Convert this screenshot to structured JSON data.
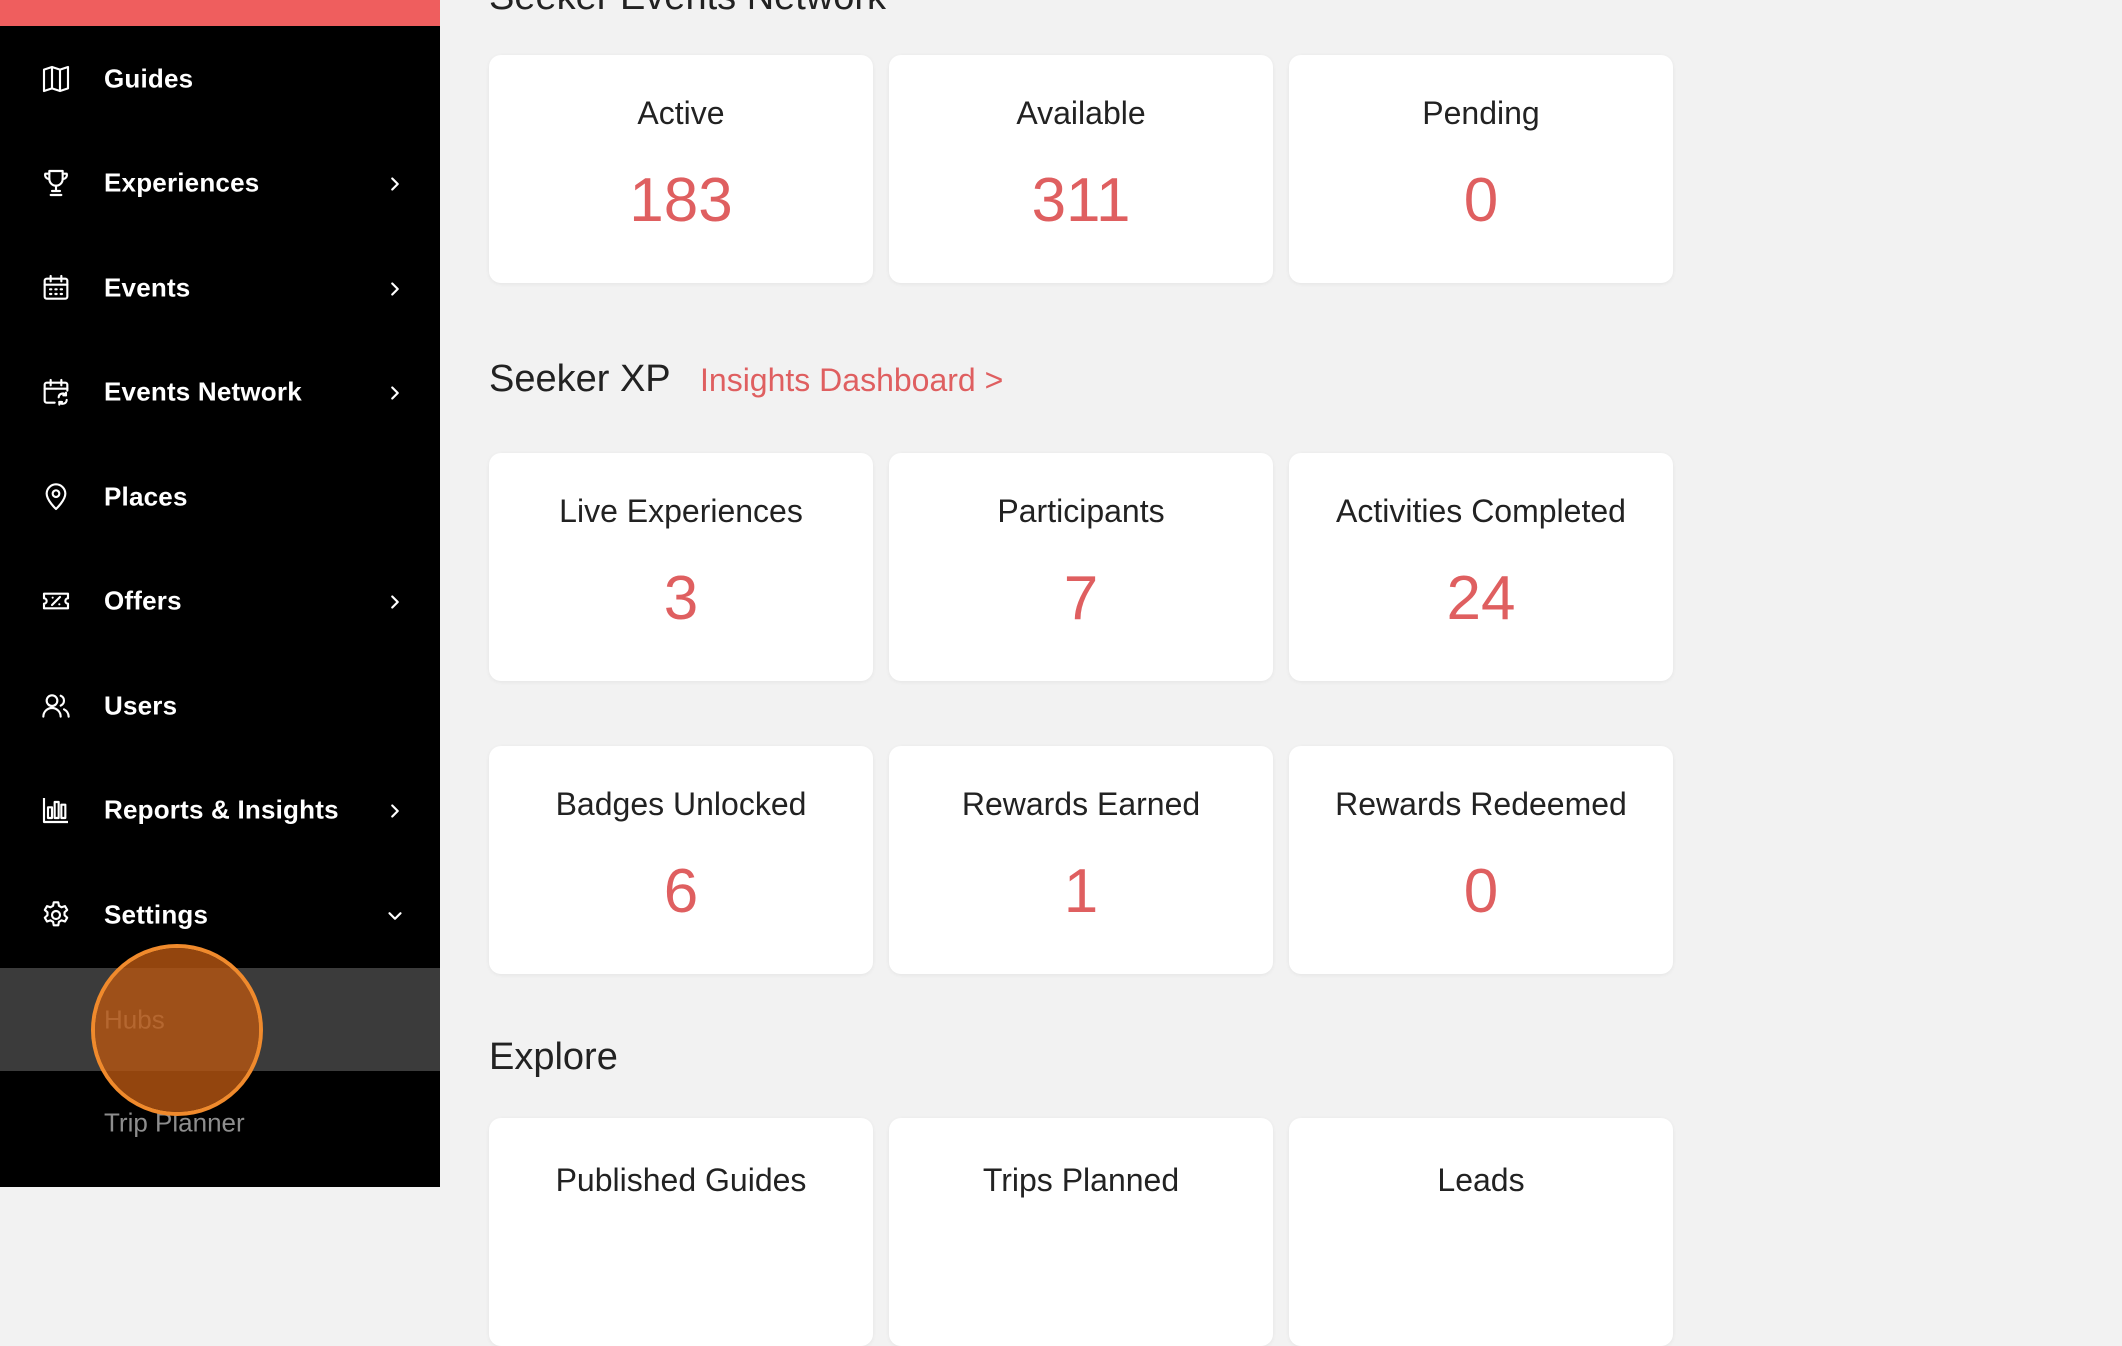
{
  "sidebar": {
    "accent_color": "#ef5e5e",
    "items": [
      {
        "label": "Guides",
        "icon": "map-icon",
        "has_children": false
      },
      {
        "label": "Experiences",
        "icon": "trophy-icon",
        "has_children": true
      },
      {
        "label": "Events",
        "icon": "calendar-icon",
        "has_children": true
      },
      {
        "label": "Events Network",
        "icon": "calendar-sync-icon",
        "has_children": true
      },
      {
        "label": "Places",
        "icon": "map-pin-icon",
        "has_children": false
      },
      {
        "label": "Offers",
        "icon": "ticket-icon",
        "has_children": true
      },
      {
        "label": "Users",
        "icon": "users-icon",
        "has_children": false
      },
      {
        "label": "Reports & Insights",
        "icon": "bar-chart-icon",
        "has_children": true
      },
      {
        "label": "Settings",
        "icon": "gear-icon",
        "has_children": true,
        "expanded": true
      }
    ],
    "settings_subitems": [
      {
        "label": "Hubs",
        "active": true
      },
      {
        "label": "Trip Planner",
        "active": false
      }
    ]
  },
  "main": {
    "events_network": {
      "title": "Seeker Events Network",
      "cards": [
        {
          "label": "Active",
          "value": "183"
        },
        {
          "label": "Available",
          "value": "311"
        },
        {
          "label": "Pending",
          "value": "0"
        }
      ]
    },
    "seeker_xp": {
      "title": "Seeker XP",
      "link": "Insights Dashboard >",
      "cards_row1": [
        {
          "label": "Live Experiences",
          "value": "3"
        },
        {
          "label": "Participants",
          "value": "7"
        },
        {
          "label": "Activities Completed",
          "value": "24"
        }
      ],
      "cards_row2": [
        {
          "label": "Badges Unlocked",
          "value": "6"
        },
        {
          "label": "Rewards Earned",
          "value": "1"
        },
        {
          "label": "Rewards Redeemed",
          "value": "0"
        }
      ]
    },
    "explore": {
      "title": "Explore",
      "cards": [
        {
          "label": "Published Guides"
        },
        {
          "label": "Trips Planned"
        },
        {
          "label": "Leads"
        }
      ]
    }
  },
  "colors": {
    "value_red": "#df5f60",
    "sidebar_bg": "#000000",
    "page_bg": "#f2f2f2"
  }
}
